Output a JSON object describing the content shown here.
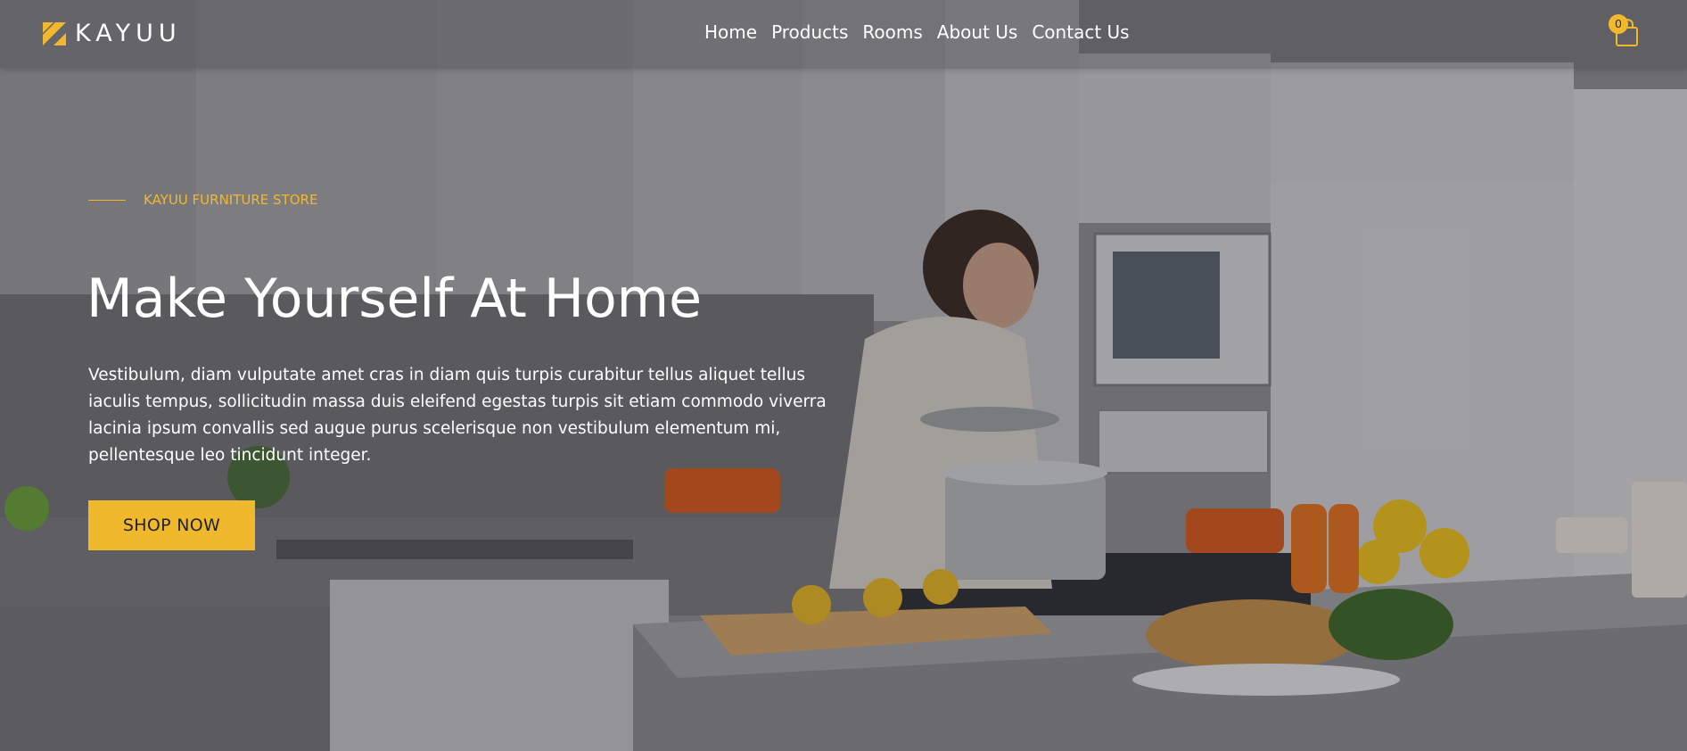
{
  "header": {
    "brand": "KAYUU",
    "nav": [
      "Home",
      "Products",
      "Rooms",
      "About Us",
      "Contact Us"
    ],
    "cart_count": "0"
  },
  "hero": {
    "eyebrow": "KAYUU FURNITURE STORE",
    "title": "Make Yourself At Home",
    "body": "Vestibulum, diam vulputate amet cras in diam quis turpis curabitur tellus aliquet tellus iaculis tempus, sollicitudin massa duis eleifend egestas turpis sit etiam commodo viverra lacinia ipsum convallis sed augue purus scelerisque non vestibulum elementum mi, pellentesque leo tincidunt integer.",
    "cta": "SHOP NOW"
  },
  "icons": {
    "logo": "kayuu-logo-icon",
    "cart": "shopping-bag-icon"
  },
  "colors": {
    "accent": "#f0b92d",
    "text": "#ffffff"
  }
}
